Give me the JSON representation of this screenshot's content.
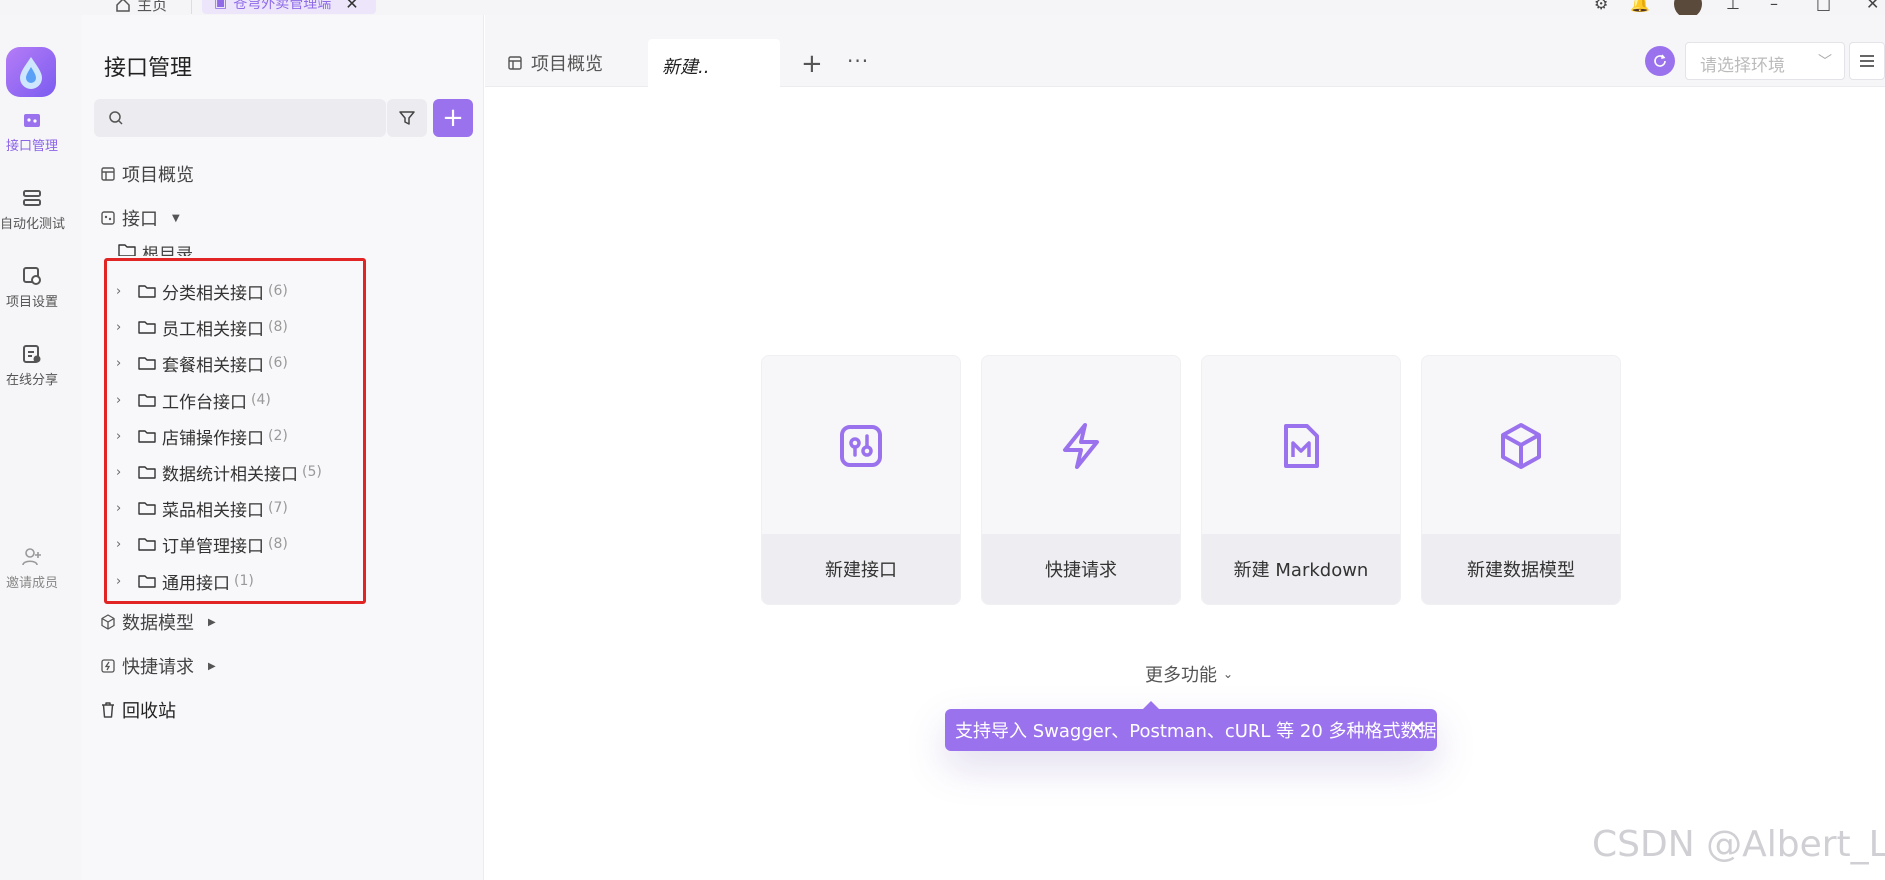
{
  "titlebar": {
    "home_label": "主页",
    "tab_label": "苍穹外卖管理端"
  },
  "rail": {
    "items": [
      {
        "label": "接口管理",
        "icon": "api-icon",
        "active": true
      },
      {
        "label": "自动化测试",
        "icon": "automation-icon"
      },
      {
        "label": "项目设置",
        "icon": "project-settings-icon"
      },
      {
        "label": "在线分享",
        "icon": "share-icon"
      },
      {
        "label": "邀请成员",
        "icon": "invite-member-icon"
      }
    ]
  },
  "sidebar": {
    "title": "接口管理",
    "nav": {
      "overview": "项目概览",
      "api": "接口",
      "root": "根目录",
      "data_model": "数据模型",
      "quick_request": "快捷请求",
      "recycle": "回收站"
    },
    "folders": [
      {
        "name": "分类相关接口",
        "count": "(6)"
      },
      {
        "name": "员工相关接口",
        "count": "(8)"
      },
      {
        "name": "套餐相关接口",
        "count": "(6)"
      },
      {
        "name": "工作台接口",
        "count": "(4)"
      },
      {
        "name": "店铺操作接口",
        "count": "(2)"
      },
      {
        "name": "数据统计相关接口",
        "count": "(5)"
      },
      {
        "name": "菜品相关接口",
        "count": "(7)"
      },
      {
        "name": "订单管理接口",
        "count": "(8)"
      },
      {
        "name": "通用接口",
        "count": "(1)"
      }
    ]
  },
  "main": {
    "tabs": {
      "overview": "项目概览",
      "new": "新建.."
    },
    "env_placeholder": "请选择环境",
    "cards": [
      {
        "label": "新建接口",
        "icon": "new-api-icon"
      },
      {
        "label": "快捷请求",
        "icon": "lightning-icon"
      },
      {
        "label": "新建 Markdown",
        "icon": "markdown-icon"
      },
      {
        "label": "新建数据模型",
        "icon": "cube-icon"
      }
    ],
    "more_functions": "更多功能",
    "tooltip": "支持导入 Swagger、Postman、cURL 等 20 多种格式数据"
  },
  "watermark": "CSDN @Albert_LG",
  "colors": {
    "accent": "#9b72ee",
    "highlight_box": "#e12525"
  }
}
